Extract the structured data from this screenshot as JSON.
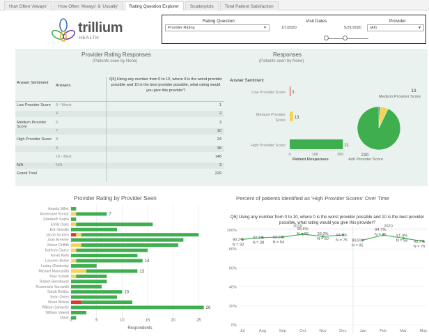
{
  "tabs": [
    {
      "label": "How Often 'Always'",
      "active": false
    },
    {
      "label": "How Often 'Always' & 'Usually'",
      "active": false
    },
    {
      "label": "Rating Question Explorer",
      "active": true
    },
    {
      "label": "Scatterplots",
      "active": false
    },
    {
      "label": "Total Patient Satisfaction",
      "active": false
    }
  ],
  "logo": {
    "word": "trillium",
    "sub": "HEALTH",
    "icon": "trillium-flower-logo"
  },
  "filters": {
    "rating_question_label": "Rating Question",
    "rating_question_value": "Provider Rating",
    "visit_dates_label": "Visit Dates",
    "start_date": "1/1/2020",
    "end_date": "5/31/2020",
    "provider_label": "Provider",
    "provider_value": "(All)"
  },
  "table": {
    "title": "Provider Rating Responses",
    "subtitle": "(Patients seen by None)",
    "col_sentiment": "Answer Sentiment",
    "col_answers": "Answers",
    "col_question": "Q5] Using any number from 0 to 10, where 0 is the worst provider possible and 10 is the best provider possible, what rating would you give this provider?",
    "rows": [
      {
        "sentiment": "Low Provider Score",
        "answer": "0 - Worst",
        "value": "1",
        "shade": false
      },
      {
        "sentiment": "",
        "answer": "4",
        "value": "2",
        "shade": true
      },
      {
        "sentiment": "Medium Provider Score",
        "answer": "5",
        "value": "3",
        "shade": false
      },
      {
        "sentiment": "",
        "answer": "7",
        "value": "10",
        "shade": true
      },
      {
        "sentiment": "High Provider Score",
        "answer": "8",
        "value": "24",
        "shade": false
      },
      {
        "sentiment": "",
        "answer": "9",
        "value": "38",
        "shade": true
      },
      {
        "sentiment": "",
        "answer": "10 - Best",
        "value": "148",
        "shade": false
      },
      {
        "sentiment": "N/A",
        "answer": "N/A",
        "value": "3",
        "shade": true
      },
      {
        "sentiment": "Grand Total",
        "answer": "",
        "value": "229",
        "shade": false
      }
    ]
  },
  "responses": {
    "title": "Responses",
    "subtitle": "(Patients seen by None)",
    "axis_title": "Answer Sentiment",
    "xlabel": "Patient Responses"
  },
  "provider_chart_title": "Provider Rating by Provider Seen",
  "pct_chart": {
    "title": "Percent of patients identified as 'High Provider Scores' Over Time",
    "question": "Q5] Using any number from 0 to 10, where 0 is the worst provider possible and 10 is the best provider possible, what rating would you give this provider?"
  },
  "colors": {
    "green": "#3fae4f",
    "yellow": "#f3d35a",
    "red": "#d73a30",
    "panel": "#eaf2ef"
  },
  "chart_data": [
    {
      "type": "bar",
      "orientation": "horizontal",
      "title": "",
      "categories": [
        "Low Provider Score",
        "Medium Provider Score",
        "High Provider Score"
      ],
      "values": [
        3,
        13,
        210
      ],
      "colors": [
        "#d9534f",
        "#f3d35a",
        "#3fae4f"
      ],
      "xlabel": "Patient Responses",
      "ylabel": "Answer Sentiment",
      "xlim": [
        0,
        220
      ],
      "xticks": [
        0,
        100,
        200
      ]
    },
    {
      "type": "pie",
      "title": "",
      "labels": [
        "High Provider Score",
        "Medium Provider Score",
        "Low Provider Score"
      ],
      "values": [
        210,
        13,
        3
      ],
      "colors": [
        "#3fae4f",
        "#f3d35a",
        "#d9534f"
      ],
      "data_labels": [
        "210",
        "13",
        ""
      ]
    },
    {
      "type": "bar",
      "orientation": "horizontal",
      "stacked": true,
      "title": "Provider Rating by Provider Seen",
      "xlabel": "Respondents",
      "ylabel": "",
      "xlim": [
        0,
        27
      ],
      "xticks": [
        0,
        5,
        10,
        15,
        20,
        25
      ],
      "categories": [
        "Angela Miller",
        "Annemarie Kontor",
        "Elizabeth Supre",
        "Emily Duke",
        "Erin Grindle",
        "Jacob Scutaru",
        "Joan Brenner",
        "Jolene Griffith",
        "Kathryn Clurce",
        "Kevin Klein",
        "Laureen Burke",
        "Lesley Glowinsky",
        "Michael Mancarido",
        "Paul Scheib",
        "Robert Biernbaum",
        "Rosemarie Surowski",
        "Sarah Bolduc",
        "Sean Owen",
        "Shani Wilson",
        "William Schaefer",
        "William Valenti",
        "Other"
      ],
      "series": [
        {
          "name": "Low Provider Score",
          "color": "#d73a30",
          "values": [
            0,
            0,
            0,
            0,
            0,
            1,
            0,
            0,
            0,
            0,
            0,
            0,
            0,
            0,
            0,
            0,
            0,
            0,
            2,
            0,
            0,
            0
          ]
        },
        {
          "name": "Medium Provider Score",
          "color": "#f3d35a",
          "values": [
            0,
            1,
            0,
            1,
            0,
            1,
            0,
            2,
            1,
            0,
            1,
            0,
            3,
            1,
            0,
            0,
            0,
            0,
            0,
            0,
            0,
            0
          ]
        },
        {
          "name": "High Provider Score",
          "color": "#3fae4f",
          "values": [
            1,
            6,
            1,
            15,
            9,
            23,
            22,
            19,
            14,
            13,
            13,
            5,
            10,
            6,
            7,
            6,
            10,
            9,
            10,
            26,
            3,
            1
          ]
        }
      ],
      "data_labels": [
        null,
        "7",
        null,
        null,
        null,
        null,
        null,
        null,
        null,
        null,
        "14",
        null,
        "13",
        null,
        null,
        null,
        "10",
        null,
        null,
        "26",
        null,
        null
      ]
    },
    {
      "type": "line",
      "title": "Percent of patients identified as 'High Provider Scores' Over Time",
      "x": [
        "Jul",
        "Aug",
        "Sep",
        "Oct",
        "Nov",
        "Dec",
        "Jan",
        "Feb",
        "Mar",
        "May"
      ],
      "year_groups": [
        {
          "label": "2019",
          "months": [
            "Jul",
            "Aug",
            "Sep",
            "Oct",
            "Nov",
            "Dec"
          ]
        },
        {
          "label": "2020",
          "months": [
            "Jan",
            "Feb",
            "Mar",
            "May"
          ]
        }
      ],
      "series": [
        {
          "values": [
            90.2,
            92.1,
            92.6,
            95.6,
            93.3,
            94.7,
            89.5,
            94.7,
            91.4,
            88.2
          ]
        }
      ],
      "data_labels": [
        "90.2%",
        "92.1%",
        "92.6%",
        "95.6%",
        "93.3%",
        "94.7%",
        "89.5%",
        "94.7%",
        "91.4%",
        "88.2%"
      ],
      "n_labels": [
        "N = 92",
        "N = 38",
        "N = 54",
        "N = 66",
        "N = 60",
        "N = 75",
        "N = 95",
        "N = 76",
        "N = 58",
        "N = 76"
      ],
      "ylim": [
        0,
        100
      ],
      "yticks": [
        "0%",
        "20%",
        "40%",
        "60%",
        "80%",
        "100%"
      ]
    }
  ]
}
